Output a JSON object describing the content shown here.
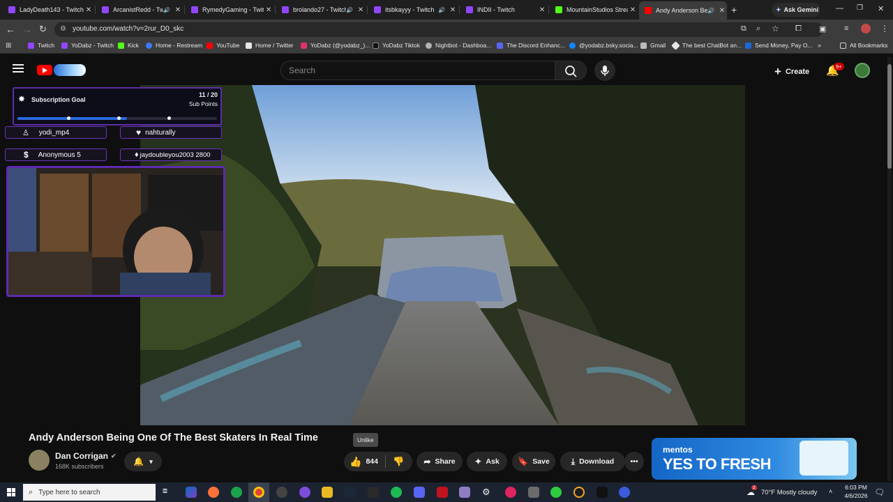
{
  "browser": {
    "tabs": [
      {
        "title": "LadyDeath143 - Twitch",
        "color": "#9146ff"
      },
      {
        "title": "ArcanistRedd - Twitch",
        "color": "#9146ff"
      },
      {
        "title": "RymedyGaming - Twitch",
        "color": "#9146ff"
      },
      {
        "title": "brolando27 - Twitch",
        "color": "#9146ff"
      },
      {
        "title": "itsbkayyy - Twitch",
        "color": "#9146ff"
      },
      {
        "title": "INDII - Twitch",
        "color": "#9146ff"
      },
      {
        "title": "MountainStudios Strea",
        "color": "#53fc18"
      },
      {
        "title": "Andy Anderson Be",
        "color": "#ff0000"
      }
    ],
    "ask_gemini": "Ask Gemini",
    "url": "youtube.com/watch?v=2rur_D0_skc",
    "bookmarks": [
      {
        "label": "Twitch",
        "color": "#9146ff"
      },
      {
        "label": "YoDabz - Twitch",
        "color": "#9146ff"
      },
      {
        "label": "Kick",
        "color": "#53fc18"
      },
      {
        "label": "Home - Restream",
        "color": "#3a7cf6"
      },
      {
        "label": "YouTube",
        "color": "#ff0000"
      },
      {
        "label": "Home / Twitter",
        "color": "#e6e6e6"
      },
      {
        "label": "YoDabz (@yodabz_)...",
        "color": "#e1306c"
      },
      {
        "label": "YoDabz Tiktok",
        "color": "#111111"
      },
      {
        "label": "Nightbot - Dashboa...",
        "color": "#b3b3b3"
      },
      {
        "label": "The Discord Enhanc...",
        "color": "#5865f2"
      },
      {
        "label": "@yodabz.bsky.socia...",
        "color": "#1185fe"
      },
      {
        "label": "Gmail",
        "color": "#bdbdbd"
      },
      {
        "label": "The best ChatBot an...",
        "color": "#e6e6e6"
      },
      {
        "label": "Send Money, Pay O...",
        "color": "#1a6bd6"
      }
    ],
    "all_bookmarks": "All Bookmarks"
  },
  "youtube": {
    "search_placeholder": "Search",
    "create_label": "Create",
    "notif_badge": "9+",
    "video_title": "Andy Anderson Being One Of The Best Skaters In Real Time",
    "channel": "Dan Corrigan",
    "subscribers": "168K subscribers",
    "tooltip": "Unlike",
    "likes": "844",
    "share": "Share",
    "ask": "Ask",
    "save": "Save",
    "download": "Download",
    "ad_brand": "mentos",
    "ad_text": "YES TO FRESH"
  },
  "overlay": {
    "goal_title": "Subscription Goal",
    "goal_count": "11 / 20",
    "goal_unit": "Sub Points",
    "goal_progress": 0.55,
    "chips": [
      {
        "label": "yodi_mp4"
      },
      {
        "label": "nahturally"
      },
      {
        "label": "Anonymous 5"
      },
      {
        "label": "jaydoubleyou2003 2800"
      }
    ]
  },
  "taskbar": {
    "search_placeholder": "Type here to search",
    "weather": "70°F  Mostly cloudy",
    "time": "6:03 PM",
    "date": "4/6/2026",
    "notif_count": "2"
  }
}
